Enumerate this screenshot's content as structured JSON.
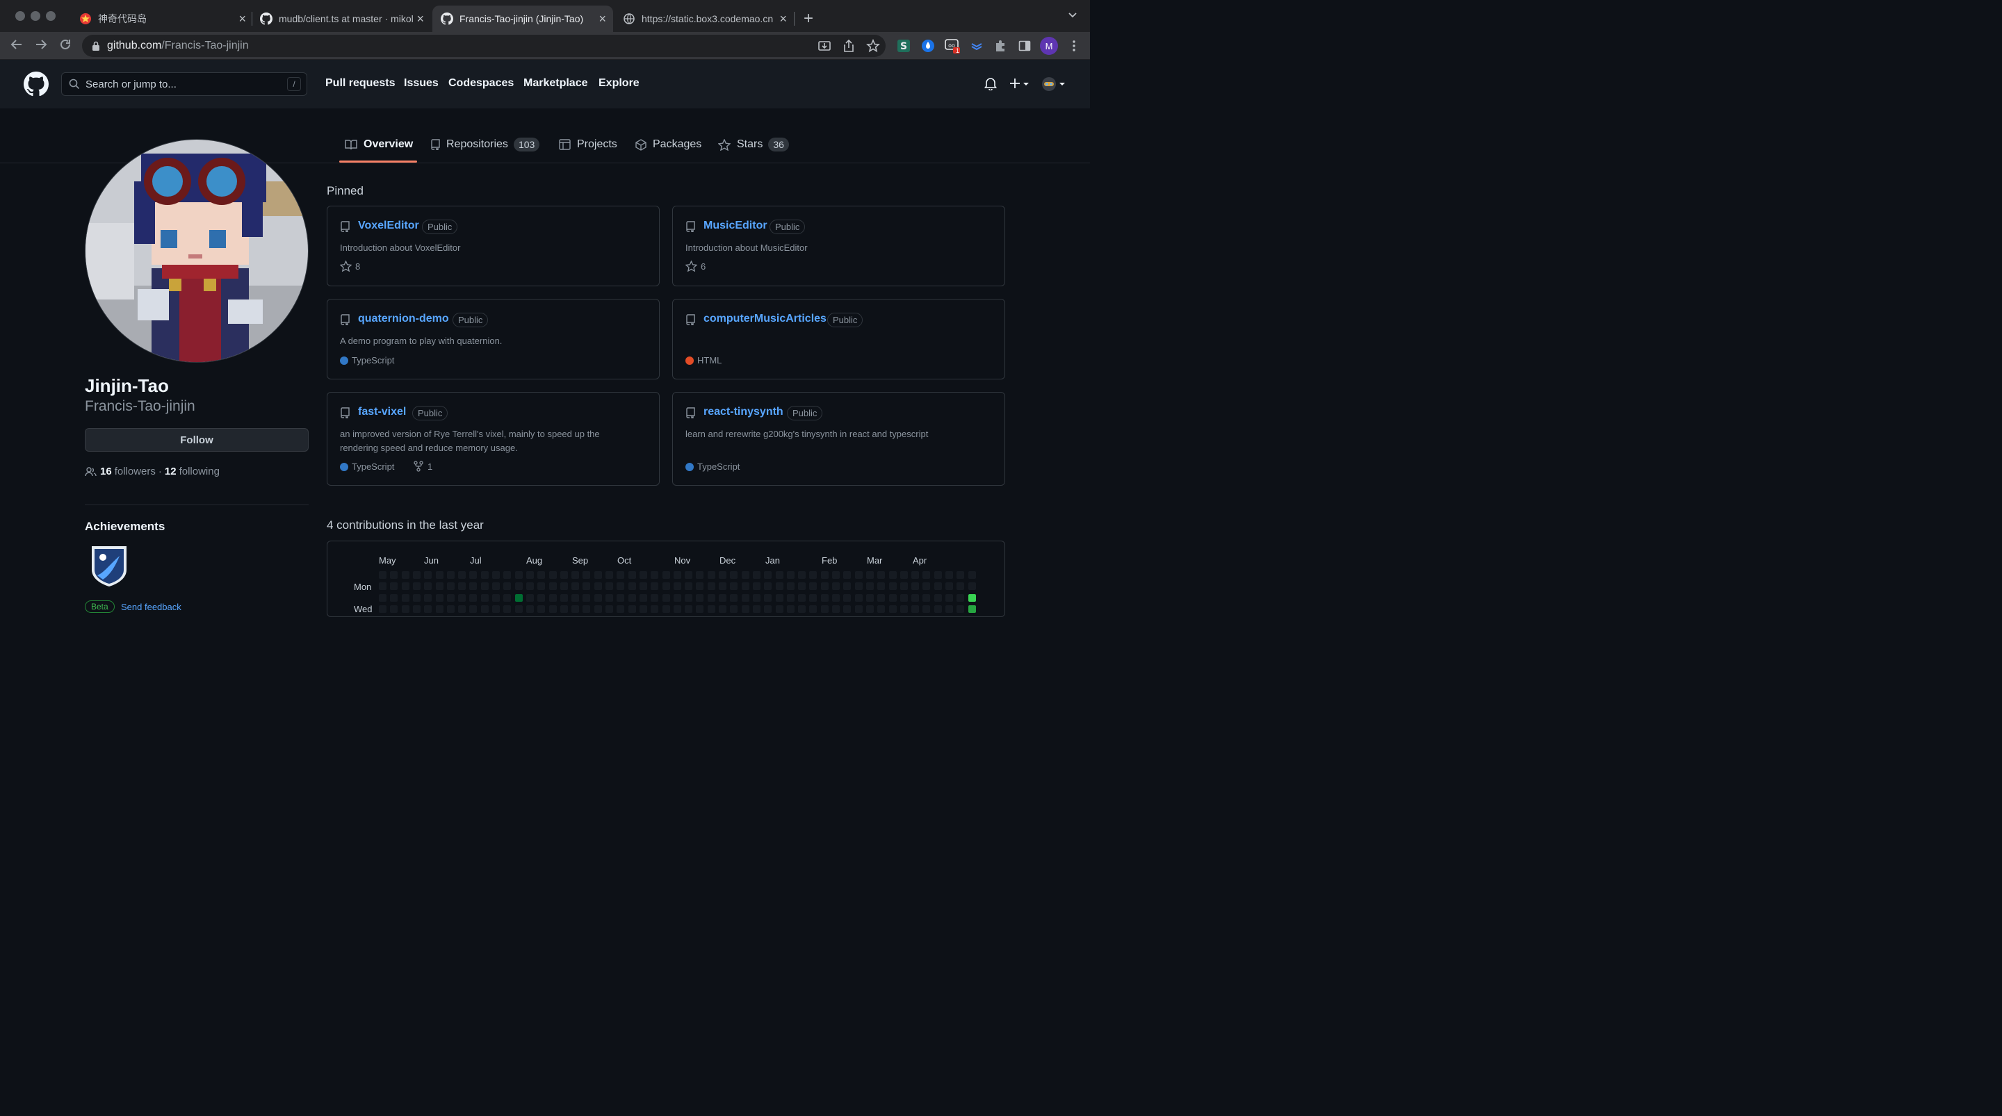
{
  "browser": {
    "tabs": [
      {
        "title": "神奇代码岛",
        "icon": "red-star-favicon-icon"
      },
      {
        "title": "mudb/client.ts at master · mikol",
        "icon": "github-favicon-icon"
      },
      {
        "title": "Francis-Tao-jinjin (Jinjin-Tao)",
        "icon": "github-favicon-icon"
      },
      {
        "title": "https://static.box3.codemao.cn",
        "icon": "globe-icon"
      }
    ],
    "url_host": "github.com",
    "url_path": "/Francis-Tao-jinjin",
    "extension_badge": "1",
    "profile_initial": "M"
  },
  "github": {
    "search_placeholder": "Search or jump to...",
    "search_key": "/",
    "nav": [
      "Pull requests",
      "Issues",
      "Codespaces",
      "Marketplace",
      "Explore"
    ]
  },
  "profile_tabs": {
    "overview": "Overview",
    "repositories": "Repositories",
    "repositories_count": "103",
    "projects": "Projects",
    "packages": "Packages",
    "stars": "Stars",
    "stars_count": "36"
  },
  "profile": {
    "name": "Jinjin-Tao",
    "login": "Francis-Tao-jinjin",
    "follow_label": "Follow",
    "followers_count": "16",
    "followers_label": "followers",
    "separator": "·",
    "following_count": "12",
    "following_label": "following",
    "achievements_title": "Achievements",
    "beta_label": "Beta",
    "feedback_label": "Send feedback"
  },
  "pinned": {
    "title": "Pinned",
    "public_label": "Public",
    "cards": [
      {
        "name": "VoxelEditor",
        "desc": "Introduction about VoxelEditor",
        "stars": "8"
      },
      {
        "name": "MusicEditor",
        "desc": "Introduction about MusicEditor",
        "stars": "6"
      },
      {
        "name": "quaternion-demo",
        "desc": "A demo program to play with quaternion.",
        "lang": "TypeScript",
        "lang_color": "#3178c6"
      },
      {
        "name": "computerMusicArticles",
        "desc": "",
        "lang": "HTML",
        "lang_color": "#e34c26"
      },
      {
        "name": "fast-vixel",
        "desc": "an improved version of Rye Terrell's vixel, mainly to speed up the rendering speed and reduce memory usage.",
        "lang": "TypeScript",
        "lang_color": "#3178c6",
        "forks": "1"
      },
      {
        "name": "react-tinysynth",
        "desc": "learn and rerewrite g200kg's tinysynth in react and typescript",
        "lang": "TypeScript",
        "lang_color": "#3178c6"
      }
    ]
  },
  "contributions": {
    "title": "4 contributions in the last year",
    "months": [
      "May",
      "Jun",
      "Jul",
      "Aug",
      "Sep",
      "Oct",
      "Nov",
      "Dec",
      "Jan",
      "Feb",
      "Mar",
      "Apr"
    ],
    "day_labels": [
      "Mon",
      "Wed"
    ],
    "empty_color": "#161b22",
    "level_colors": [
      "#0e4429",
      "#006d32",
      "#26a641",
      "#39d353"
    ]
  }
}
